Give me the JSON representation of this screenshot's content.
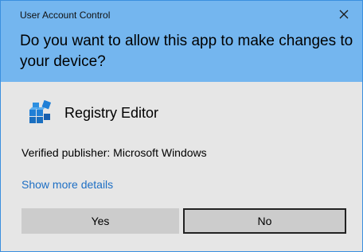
{
  "window": {
    "title": "User Account Control",
    "close_icon": "close-icon"
  },
  "prompt": {
    "question": "Do you want to allow this app to make changes to your device?"
  },
  "app": {
    "name": "Registry Editor",
    "icon": "registry-editor-icon"
  },
  "publisher": {
    "text": "Verified publisher: Microsoft Windows"
  },
  "links": {
    "show_more_details": "Show more details"
  },
  "buttons": {
    "yes": "Yes",
    "no": "No"
  },
  "colors": {
    "header_bg": "#74b6ef",
    "body_bg": "#e6e6e6",
    "link": "#1e6fc4",
    "button_bg": "#cccccc",
    "focus_border": "#222222",
    "icon_blue": "#1f7fd6"
  }
}
